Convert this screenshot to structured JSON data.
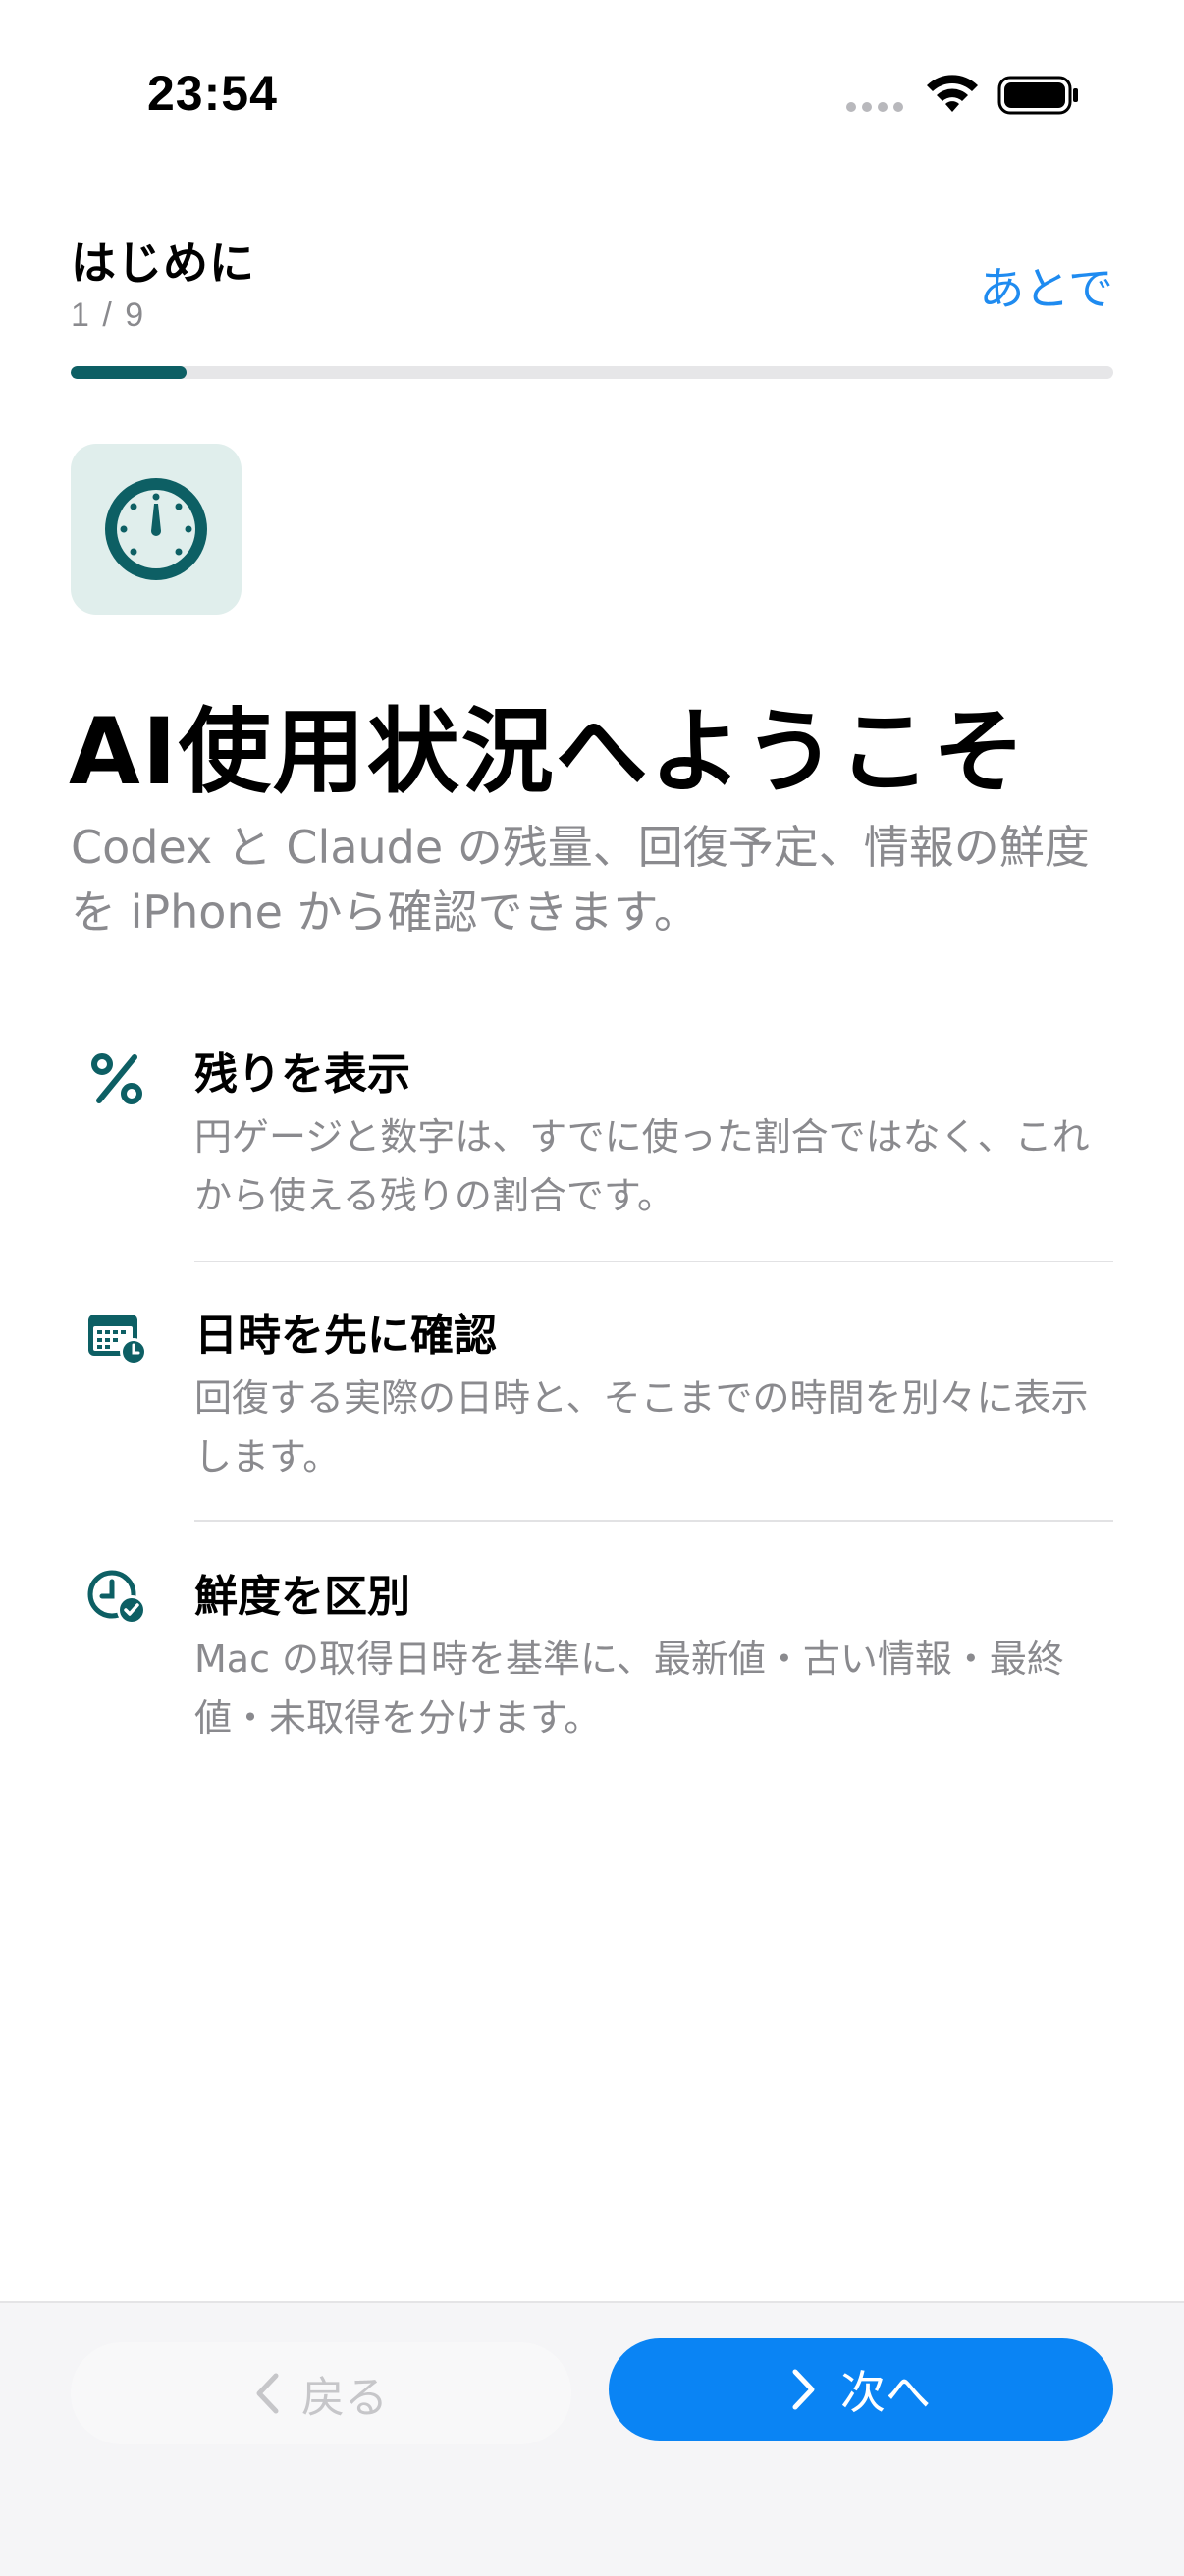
{
  "status_bar": {
    "time": "23:54"
  },
  "header": {
    "title": "はじめに",
    "counter": "1 / 9",
    "later_label": "あとで",
    "progress": 0.111
  },
  "welcome": {
    "title": "AI使用状況へようこそ",
    "description": "Codex と Claude の残量、回復予定、情報の鮮度を iPhone から確認できます。"
  },
  "features": [
    {
      "icon": "percent-icon",
      "title": "残りを表示",
      "description": "円ゲージと数字は、すでに使った割合ではなく、これから使える残りの割合です。"
    },
    {
      "icon": "calendar-clock-icon",
      "title": "日時を先に確認",
      "description": "回復する実際の日時と、そこまでの時間を別々に表示します。"
    },
    {
      "icon": "clock-check-icon",
      "title": "鮮度を区別",
      "description": "Mac の取得日時を基準に、最新値・古い情報・最終値・未取得を分けます。"
    }
  ],
  "footer": {
    "back_label": "戻る",
    "next_label": "次へ"
  },
  "colors": {
    "accent": "#0d5f64",
    "link": "#1f8bf0",
    "primary_button": "#0a84f4",
    "secondary_text": "#8a8a8e"
  }
}
